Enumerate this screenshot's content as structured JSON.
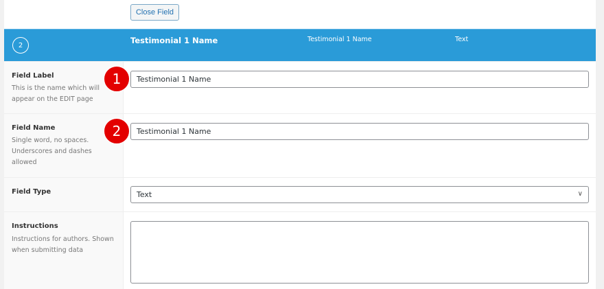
{
  "close_button": "Close Field",
  "header": {
    "order": "2",
    "label": "Testimonial 1 Name",
    "name": "Testimonial 1 Name",
    "type": "Text",
    "color": "#2a9bd8"
  },
  "fields": [
    {
      "label": "Field Label",
      "desc": "This is the name which will appear on the EDIT page",
      "value": "Testimonial 1 Name",
      "badge": "1"
    },
    {
      "label": "Field Name",
      "desc": "Single word, no spaces. Underscores and dashes allowed",
      "value": "Testimonial 1 Name",
      "badge": "2"
    },
    {
      "label": "Field Type",
      "value": "Text"
    },
    {
      "label": "Instructions",
      "desc": "Instructions for authors. Shown when submitting data",
      "value": ""
    }
  ]
}
